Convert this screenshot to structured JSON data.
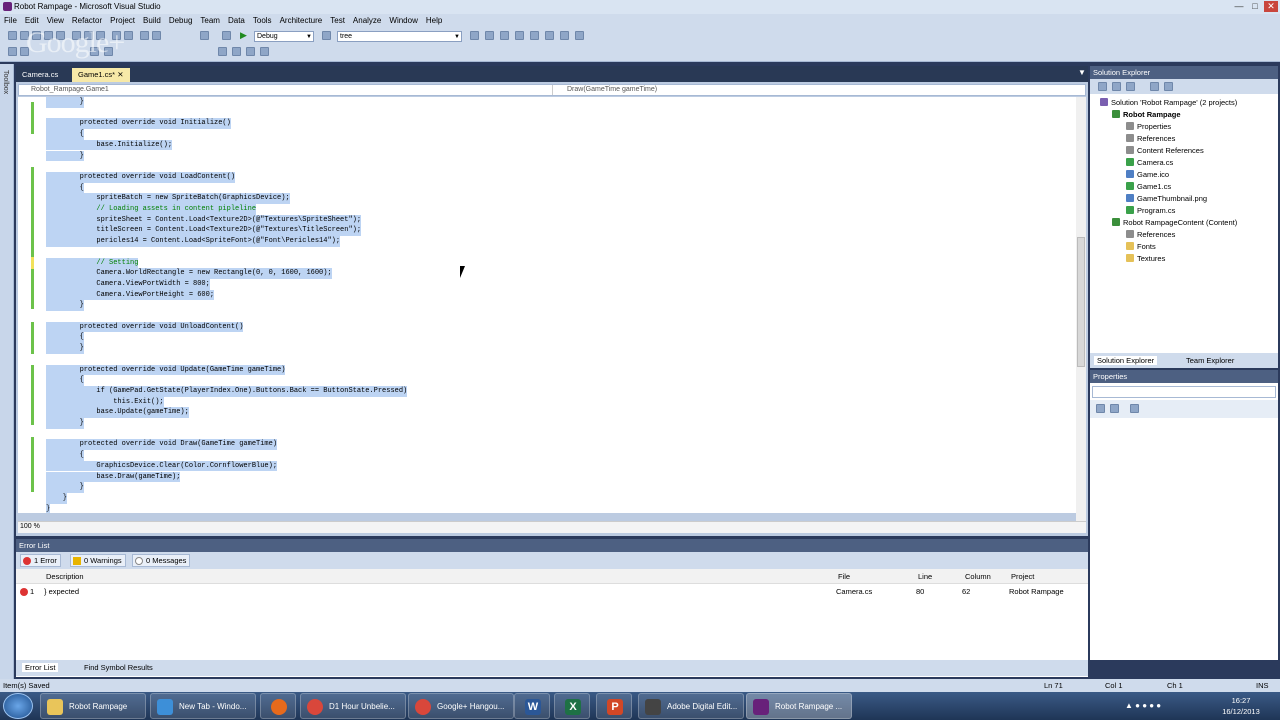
{
  "window": {
    "title": "Robot Rampage - Microsoft Visual Studio"
  },
  "menu": [
    "File",
    "Edit",
    "View",
    "Refactor",
    "Project",
    "Build",
    "Debug",
    "Team",
    "Data",
    "Tools",
    "Architecture",
    "Test",
    "Analyze",
    "Window",
    "Help"
  ],
  "toolbar": {
    "config": "Debug",
    "search": "tree"
  },
  "tabs": [
    {
      "label": "Camera.cs"
    },
    {
      "label": "Game1.cs*"
    }
  ],
  "navbar": {
    "class": "Robot_Rampage.Game1",
    "member": "Draw(GameTime gameTime)"
  },
  "code_lines": [
    "        }",
    "",
    "        protected override void Initialize()",
    "        {",
    "            base.Initialize();",
    "        }",
    "",
    "        protected override void LoadContent()",
    "        {",
    "            spriteBatch = new SpriteBatch(GraphicsDevice);",
    "            // Loading assets in content pipleline",
    "            spriteSheet = Content.Load<Texture2D>(@\"Textures\\SpriteSheet\");",
    "            titleScreen = Content.Load<Texture2D>(@\"Textures\\TitleScreen\");",
    "            pericles14 = Content.Load<SpriteFont>(@\"Font\\Pericles14\");",
    "",
    "            // Setting",
    "            Camera.WorldRectangle = new Rectangle(0, 0, 1600, 1600);",
    "            Camera.ViewPortWidth = 800;",
    "            Camera.ViewPortHeight = 600;",
    "        }",
    "",
    "        protected override void UnloadContent()",
    "        {",
    "        }",
    "",
    "        protected override void Update(GameTime gameTime)",
    "        {",
    "            if (GamePad.GetState(PlayerIndex.One).Buttons.Back == ButtonState.Pressed)",
    "                this.Exit();",
    "            base.Update(gameTime);",
    "        }",
    "",
    "        protected override void Draw(GameTime gameTime)",
    "        {",
    "            GraphicsDevice.Clear(Color.CornflowerBlue);",
    "            base.Draw(gameTime);",
    "        }",
    "    }",
    "}"
  ],
  "zoom": "100 %",
  "errorList": {
    "title": "Error List",
    "errors": "1 Error",
    "warnings": "0 Warnings",
    "messages": "0 Messages",
    "columns": {
      "description": "Description",
      "file": "File",
      "line": "Line",
      "column": "Column",
      "project": "Project"
    },
    "row": {
      "num": "1",
      "description": "} expected",
      "file": "Camera.cs",
      "line": "80",
      "column": "62",
      "project": "Robot Rampage"
    }
  },
  "bottomTabs": {
    "errorList": "Error List",
    "findSymbol": "Find Symbol Results"
  },
  "solutionExplorer": {
    "title": "Solution Explorer",
    "items": [
      {
        "label": "Solution 'Robot Rampage' (2 projects)"
      },
      {
        "label": "Robot Rampage"
      },
      {
        "label": "Properties"
      },
      {
        "label": "References"
      },
      {
        "label": "Content References"
      },
      {
        "label": "Camera.cs"
      },
      {
        "label": "Game.ico"
      },
      {
        "label": "Game1.cs"
      },
      {
        "label": "GameThumbnail.png"
      },
      {
        "label": "Program.cs"
      },
      {
        "label": "Robot RampageContent (Content)"
      },
      {
        "label": "References"
      },
      {
        "label": "Fonts"
      },
      {
        "label": "Textures"
      }
    ],
    "tabs": {
      "se": "Solution Explorer",
      "te": "Team Explorer"
    }
  },
  "properties": {
    "title": "Properties"
  },
  "toolbox": "Toolbox",
  "status": {
    "left": "Item(s) Saved",
    "ln": "Ln 71",
    "col": "Col 1",
    "ch": "Ch 1",
    "ins": "INS"
  },
  "taskbar": [
    {
      "label": "Robot Rampage"
    },
    {
      "label": "New Tab - Windo..."
    },
    {
      "label": "D1 Hour Unbelie..."
    },
    {
      "label": "Google+ Hangou..."
    },
    {
      "label": "Adobe Digital Edit..."
    },
    {
      "label": "Robot Rampage ..."
    }
  ],
  "clock": {
    "time": "16:27",
    "date": "16/12/2013"
  },
  "watermark": "Google+"
}
